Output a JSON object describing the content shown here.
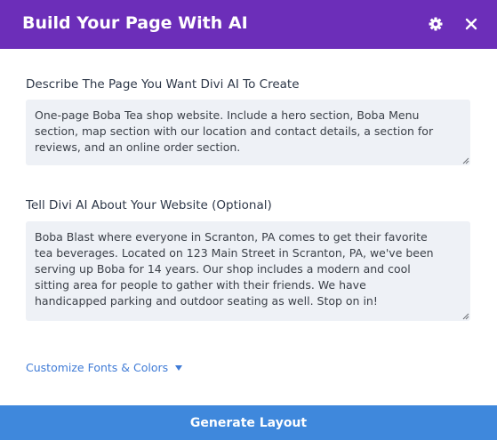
{
  "header": {
    "title": "Build Your Page With AI",
    "settings_icon": "gear-icon",
    "close_icon": "close-icon",
    "background_color": "#6c2eb9"
  },
  "form": {
    "description_label": "Describe The Page You Want Divi AI To Create",
    "description_value": "One-page Boba Tea shop website. Include a hero section, Boba Menu\nsection, map section with our location and contact details, a section for\nreviews, and an online order section.",
    "website_label": "Tell Divi AI About Your Website (Optional)",
    "website_value": "Boba Blast where everyone in Scranton, PA comes to get their favorite\ntea beverages. Located on 123 Main Street in Scranton, PA, we've been\nserving up Boba for 14 years. Our shop includes a modern and cool\nsitting area for people to gather with their friends. We have\nhandicapped parking and outdoor seating as well. Stop on in!",
    "customize_link": "Customize Fonts & Colors",
    "customize_icon": "caret-down-icon"
  },
  "footer": {
    "generate_label": "Generate Layout",
    "button_color": "#3f88dc"
  }
}
